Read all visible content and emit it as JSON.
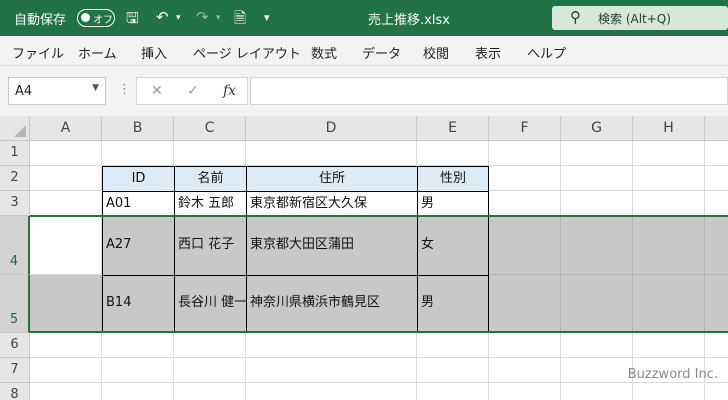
{
  "titlebar": {
    "autosave_label": "自動保存",
    "autosave_toggle": "オフ",
    "filename": "売上推移.xlsx",
    "search_placeholder": "検索 (Alt+Q)"
  },
  "ribbon": {
    "tabs": [
      "ファイル",
      "ホーム",
      "挿入",
      "ページ レイアウト",
      "数式",
      "データ",
      "校閲",
      "表示",
      "ヘルプ"
    ]
  },
  "formula_bar": {
    "name_box": "A4",
    "fx": "fx",
    "formula": ""
  },
  "columns": [
    "A",
    "B",
    "C",
    "D",
    "E",
    "F",
    "G",
    "H"
  ],
  "rows": [
    "1",
    "2",
    "3",
    "4",
    "5",
    "6",
    "7",
    "8"
  ],
  "table": {
    "header": [
      "ID",
      "名前",
      "住所",
      "性別"
    ],
    "r3": [
      "A01",
      "鈴木 五郎",
      "東京都新宿区大久保",
      "男"
    ],
    "r4": [
      "A27",
      "西口 花子",
      "東京都大田区蒲田",
      "女"
    ],
    "r5": [
      "B14",
      "長谷川 健一",
      "神奈川県横浜市鶴見区",
      "男"
    ]
  },
  "watermark": "Buzzword Inc.",
  "colors": {
    "accent": "#217346",
    "header_fill": "#ddebf7",
    "selection_shade": "#c8c8c8"
  }
}
